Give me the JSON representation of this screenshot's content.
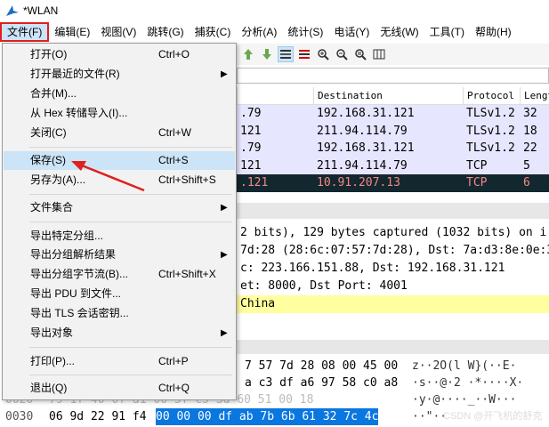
{
  "window": {
    "title": "*WLAN"
  },
  "menubar": [
    "文件(F)",
    "编辑(E)",
    "视图(V)",
    "跳转(G)",
    "捕获(C)",
    "分析(A)",
    "统计(S)",
    "电话(Y)",
    "无线(W)",
    "工具(T)",
    "帮助(H)"
  ],
  "file_menu": {
    "open": {
      "label": "打开(O)",
      "shortcut": "Ctrl+O"
    },
    "open_recent": {
      "label": "打开最近的文件(R)"
    },
    "merge": {
      "label": "合并(M)..."
    },
    "import_hex": {
      "label": "从 Hex 转储导入(I)..."
    },
    "close": {
      "label": "关闭(C)",
      "shortcut": "Ctrl+W"
    },
    "save": {
      "label": "保存(S)",
      "shortcut": "Ctrl+S"
    },
    "save_as": {
      "label": "另存为(A)...",
      "shortcut": "Ctrl+Shift+S"
    },
    "file_set": {
      "label": "文件集合"
    },
    "export_specified": {
      "label": "导出特定分组..."
    },
    "export_dissections": {
      "label": "导出分组解析结果"
    },
    "export_bytes": {
      "label": "导出分组字节流(B)...",
      "shortcut": "Ctrl+Shift+X"
    },
    "export_pdu": {
      "label": "导出 PDU 到文件..."
    },
    "export_tls": {
      "label": "导出 TLS 会话密钥..."
    },
    "export_objects": {
      "label": "导出对象"
    },
    "print": {
      "label": "打印(P)...",
      "shortcut": "Ctrl+P"
    },
    "quit": {
      "label": "退出(Q)",
      "shortcut": "Ctrl+Q"
    }
  },
  "packet_list": {
    "headers": {
      "destination": "Destination",
      "protocol": "Protocol",
      "length": "Lengt"
    },
    "rows": [
      {
        "src": ".79",
        "dst": "192.168.31.121",
        "proto": "TLSv1.2",
        "len": "32"
      },
      {
        "src": "121",
        "dst": "211.94.114.79",
        "proto": "TLSv1.2",
        "len": "18"
      },
      {
        "src": ".79",
        "dst": "192.168.31.121",
        "proto": "TLSv1.2",
        "len": "22"
      },
      {
        "src": "121",
        "dst": "211.94.114.79",
        "proto": "TCP",
        "len": "5"
      },
      {
        "src": ".121",
        "dst": "10.91.207.13",
        "proto": "TCP",
        "len": "6"
      }
    ]
  },
  "details": [
    "2 bits), 129 bytes captured (1032 bits) on i",
    "7d:28 (28:6c:07:57:7d:28), Dst: 7a:d3:8e:0e:3",
    "c: 223.166.151.88, Dst: 192.168.31.121",
    "et: 8000, Dst Port: 4001",
    "China"
  ],
  "bytes": [
    {
      "offset": "",
      "hex": "7 57 7d 28 08 00 45 00",
      "ascii": "z··2O(l W}(··E·"
    },
    {
      "offset": "",
      "hex": "a c3 df a6 97 58 c0 a8",
      "ascii": "·s··@·2 ·*····X·"
    },
    {
      "offset": "0020",
      "hex": "79 1f 40 0f a1 00 5f c5 3d 60 51 00 18",
      "ascii": "·y·@····_··W···"
    },
    {
      "offset": "0030",
      "hex_plain": "06 9d 22 91 f4",
      "hex_sel": "00 00 00  df ab 7b 6b 61 32 7c 4c",
      "ascii": "··\"··"
    }
  ],
  "watermark": "CSDN @开飞机的舒克"
}
